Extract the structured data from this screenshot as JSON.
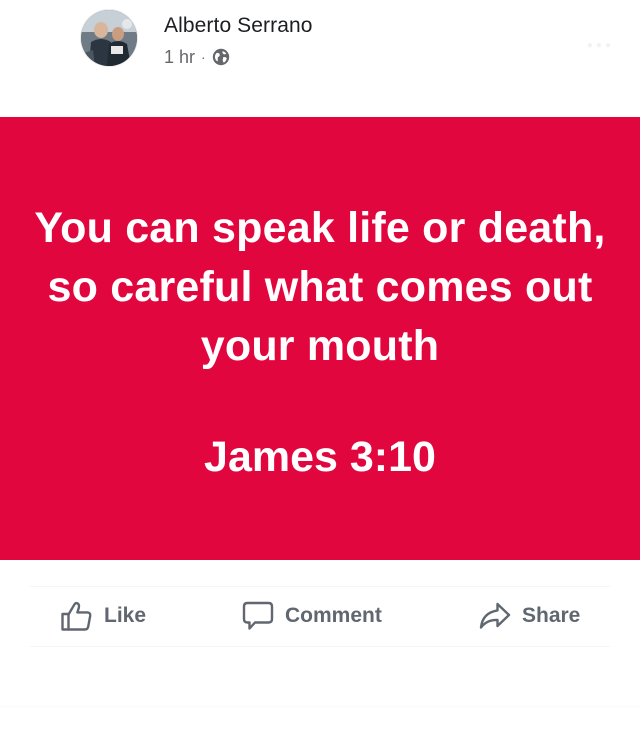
{
  "post": {
    "author_name": "Alberto Serrano",
    "timestamp": "1 hr",
    "separator": "·",
    "privacy_icon": "globe-icon",
    "image_background": "#e2063e",
    "quote_lines": "You can speak life or death, so careful what comes out your mouth",
    "verse_reference": "James 3:10"
  },
  "actions": {
    "like_label": "Like",
    "comment_label": "Comment",
    "share_label": "Share",
    "like_icon": "thumbs-up-icon",
    "comment_icon": "speech-bubble-icon",
    "share_icon": "share-arrow-icon"
  }
}
